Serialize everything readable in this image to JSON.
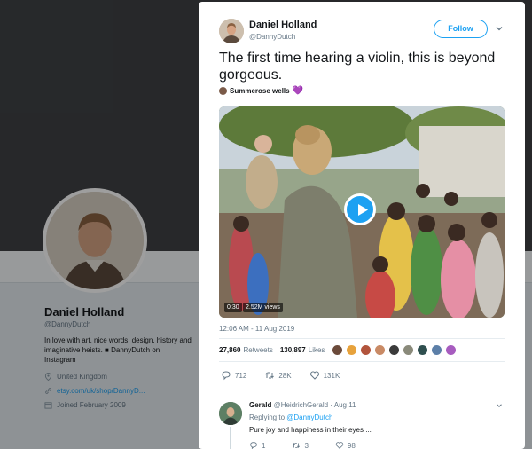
{
  "profile": {
    "name": "Daniel Holland",
    "handle": "@DannyDutch",
    "bio": "In love with art, nice words, design, history and imaginative heists. ■ DannyDutch on Instagram",
    "location": "United Kingdom",
    "link": "etsy.com/uk/shop/DannyD...",
    "joined": "Joined February 2009"
  },
  "tweet": {
    "author_name": "Daniel Holland",
    "author_handle": "@DannyDutch",
    "follow_label": "Follow",
    "text": "The first time hearing a violin, this is beyond gorgeous.",
    "mention_name": "Summerose wells",
    "mention_emoji": "💜",
    "video": {
      "time": "0:30",
      "views": "2.52M views"
    },
    "timestamp": "12:06 AM - 11 Aug 2019",
    "retweets_count": "27,860",
    "retweets_label": "Retweets",
    "likes_count": "130,897",
    "likes_label": "Likes",
    "actions": {
      "replies": "712",
      "retweets": "28K",
      "likes": "131K"
    }
  },
  "reply": {
    "name": "Gerald",
    "handle": "@HeidrichGerald",
    "date": "· Aug 11",
    "replying_prefix": "Replying to",
    "replying_to": "@DannyDutch",
    "text": "Pure joy and happiness in their eyes ...",
    "actions": {
      "replies": "1",
      "retweets": "3",
      "likes": "98"
    }
  },
  "colors": {
    "accent": "#1da1f2",
    "text": "#14171a",
    "muted": "#657786"
  },
  "icons": [
    "location-icon",
    "link-icon",
    "calendar-icon",
    "chevron-down-icon",
    "play-icon",
    "reply-icon",
    "retweet-icon",
    "heart-icon"
  ]
}
